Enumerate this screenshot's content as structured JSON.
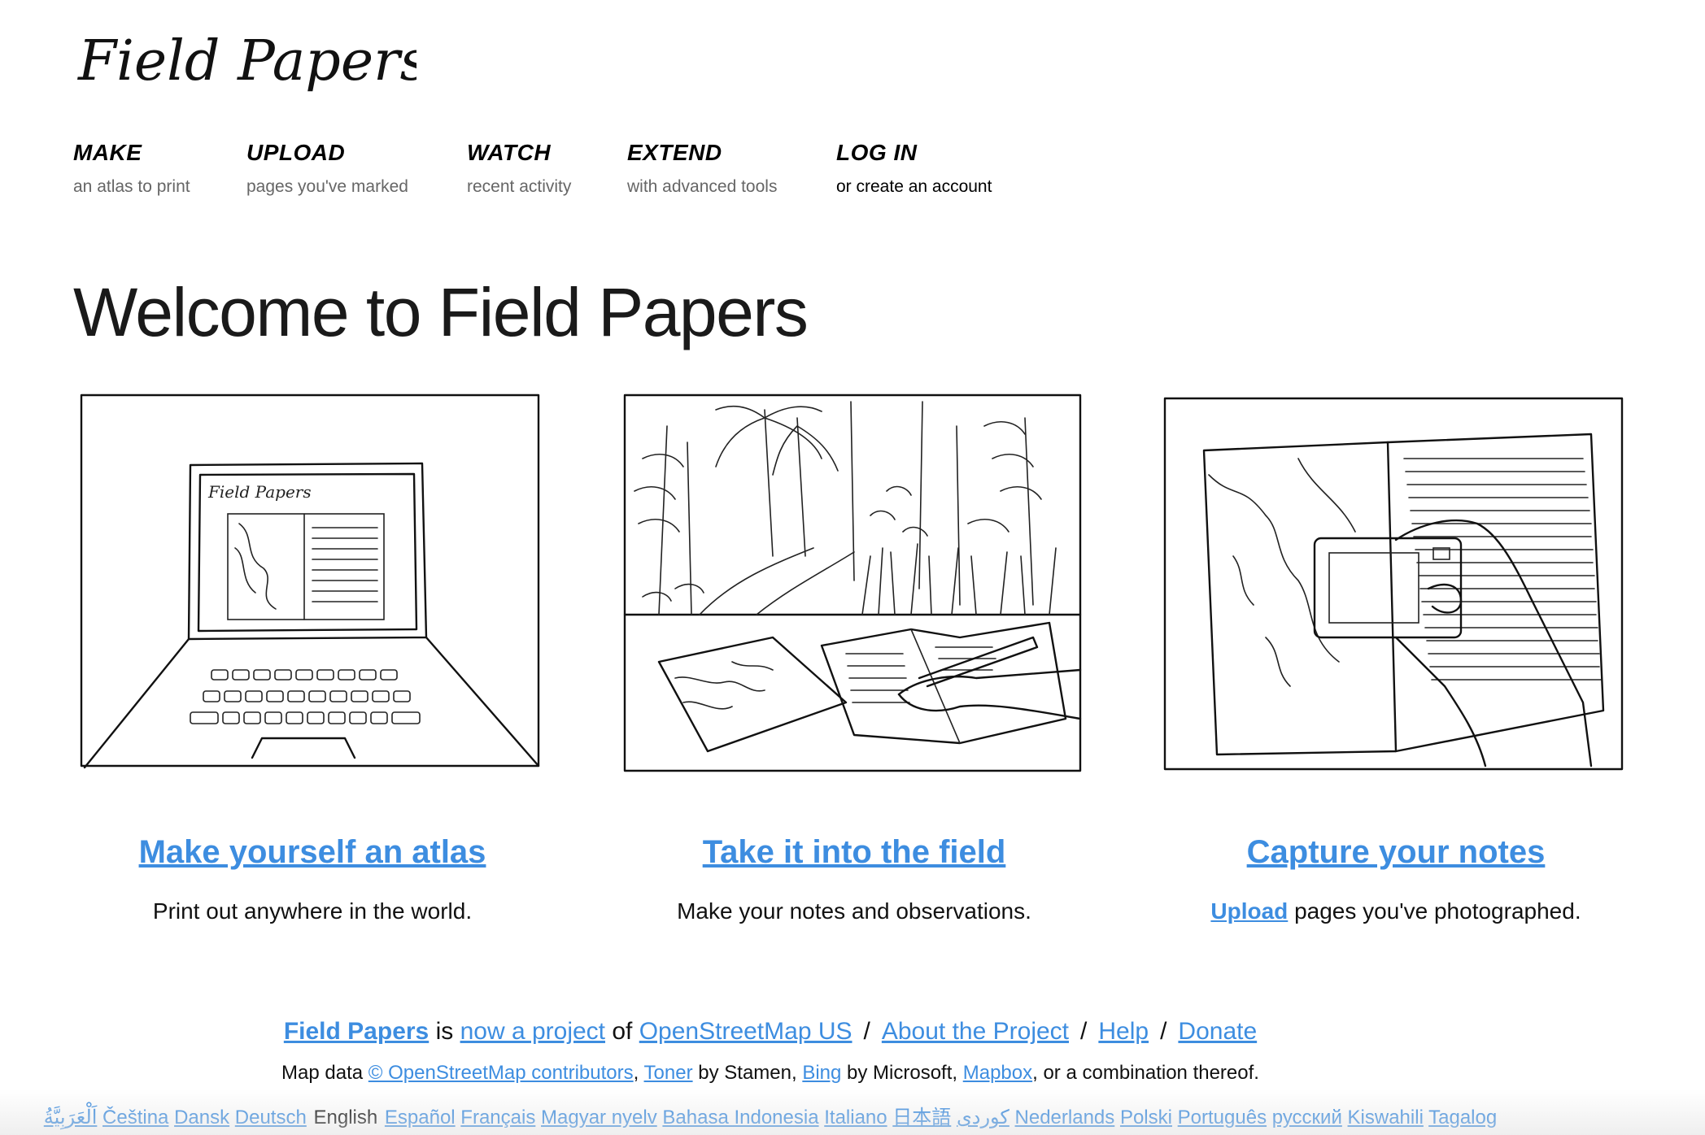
{
  "logo": {
    "text": "Field Papers"
  },
  "nav": [
    {
      "title": "MAKE",
      "subtitle": "an atlas to print"
    },
    {
      "title": "UPLOAD",
      "subtitle": "pages you've marked"
    },
    {
      "title": "WATCH",
      "subtitle": "recent activity"
    },
    {
      "title": "EXTEND",
      "subtitle": "with advanced tools"
    },
    {
      "title": "LOG IN",
      "subtitle": "or create an account"
    }
  ],
  "page_title": "Welcome to Field Papers",
  "columns": [
    {
      "heading": "Make yourself an atlas",
      "description": "Print out anywhere in the world.",
      "illustration": "laptop-sketch",
      "screen_text": "Field Papers"
    },
    {
      "heading": "Take it into the field",
      "description": "Make your notes and observations.",
      "illustration": "field-sketch"
    },
    {
      "heading": "Capture your notes",
      "description_link": "Upload",
      "description": " pages you've photographed.",
      "illustration": "camera-sketch"
    }
  ],
  "footer": {
    "line1": {
      "brand": "Field Papers",
      "is": " is ",
      "project_link": "now a project",
      "of": " of ",
      "osmus_link": "OpenStreetMap US",
      "separator": "/",
      "about": "About the Project",
      "help": "Help",
      "donate": "Donate"
    },
    "line2": {
      "prefix": "Map data ",
      "osm": "© OpenStreetMap contributors",
      "comma1": ", ",
      "toner": "Toner",
      "by_stamen": " by Stamen, ",
      "bing": "Bing",
      "by_microsoft": " by Microsoft, ",
      "mapbox": "Mapbox",
      "suffix": ", or a combination thereof."
    },
    "languages": [
      "اَلْعَرَبِيَّةُ",
      "Čeština",
      "Dansk",
      "Deutsch",
      "English",
      "Español",
      "Français",
      "Magyar nyelv",
      "Bahasa Indonesia",
      "Italiano",
      "日本語",
      "کوردی",
      "Nederlands",
      "Polski",
      "Português",
      "русский",
      "Kiswahili",
      "Tagalog"
    ],
    "current_language": "English"
  },
  "colors": {
    "link": "#3d8de0",
    "text": "#111111",
    "muted": "#666666"
  }
}
